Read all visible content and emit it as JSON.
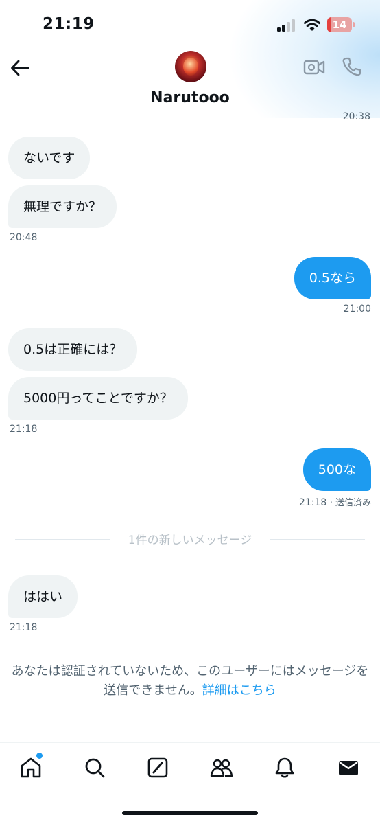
{
  "status_bar": {
    "time": "21:19",
    "battery": "14",
    "battery_level": 0.14
  },
  "header": {
    "contact_name": "Narutooo"
  },
  "clipped_timestamp": "20:38",
  "messages": [
    {
      "text": "ないです",
      "side": "in"
    },
    {
      "text": "無理ですか？",
      "side": "in",
      "time": "20:48"
    },
    {
      "text": "0.5なら",
      "side": "out",
      "time": "21:00"
    },
    {
      "text": "0.5は正確には？",
      "side": "in"
    },
    {
      "text": "5000円ってことですか？",
      "side": "in",
      "time": "21:18"
    },
    {
      "text": "500な",
      "side": "out",
      "time": "21:18",
      "status": "· 送信済み"
    },
    {
      "text": "ははい",
      "side": "in",
      "time": "21:18"
    }
  ],
  "new_messages_divider": "1件の新しいメッセージ",
  "notice": {
    "text": "あなたは認証されていないため、このユーザーにはメッセージを送信できません。",
    "link": "詳細はこちら"
  },
  "tabbar": {
    "items": [
      "home-icon",
      "search-icon",
      "grok-icon",
      "communities-icon",
      "notifications-icon",
      "messages-icon"
    ]
  },
  "colors": {
    "accent": "#1d9bf0",
    "bubble_in": "#eff3f4",
    "text_secondary": "#536471"
  }
}
